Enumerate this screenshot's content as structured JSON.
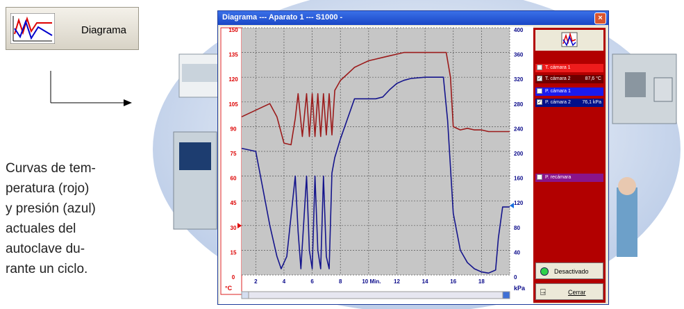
{
  "toolbar": {
    "diagram_label": "Diagrama"
  },
  "caption": {
    "lines": [
      "Curvas de tem-",
      "peratura (rojo)",
      "y presión (azul)",
      "actuales del",
      "autoclave du-",
      "rante un ciclo."
    ]
  },
  "window": {
    "title": "Diagrama --- Aparato 1 --- S1000 -",
    "close_label": "×"
  },
  "axes": {
    "left_unit": "°C",
    "right_unit": "kPa",
    "left_ticks": [
      "150",
      "135",
      "120",
      "105",
      "90",
      "75",
      "60",
      "45",
      "30",
      "15",
      "0"
    ],
    "right_ticks": [
      "400",
      "360",
      "320",
      "280",
      "240",
      "200",
      "160",
      "120",
      "80",
      "40",
      "0"
    ],
    "x_ticks": [
      "2",
      "4",
      "6",
      "8",
      "10 Min.",
      "12",
      "14",
      "16",
      "18"
    ]
  },
  "panel": {
    "channels": [
      {
        "name": "T. cámara 1",
        "value": "",
        "checked": false,
        "color": "#ee1c1c"
      },
      {
        "name": "T. cámara 2",
        "value": "87,6 °C",
        "checked": true,
        "color": "#6d0000"
      },
      {
        "name": "P. cámara 1",
        "value": "",
        "checked": false,
        "color": "#1a1aee"
      },
      {
        "name": "P. cámara 2",
        "value": "76,1 kPa",
        "checked": true,
        "color": "#000f8a"
      },
      {
        "name": "P. recámara",
        "value": "",
        "checked": false,
        "color": "#8a148a"
      }
    ],
    "status_label": "Desactivado",
    "close_label": "Cerrar"
  },
  "chart_data": {
    "type": "line",
    "x_label": "Min.",
    "xlim": [
      1,
      20
    ],
    "left_axis": {
      "unit": "°C",
      "ylim": [
        0,
        150
      ]
    },
    "right_axis": {
      "unit": "kPa",
      "ylim": [
        0,
        400
      ]
    },
    "series": [
      {
        "name": "T. cámara 2",
        "axis": "left",
        "color": "#9b1a1a",
        "x": [
          1,
          2,
          3,
          3.5,
          4,
          4.5,
          4.8,
          5,
          5.3,
          5.6,
          5.8,
          6,
          6.2,
          6.4,
          6.6,
          6.8,
          7,
          7.2,
          7.4,
          7.6,
          8,
          8.5,
          9,
          9.5,
          10,
          10.5,
          11,
          11.5,
          12,
          12.5,
          13,
          14,
          15,
          15.5,
          15.8,
          16,
          16.5,
          17,
          17.5,
          18,
          18.5,
          19,
          19.5,
          20
        ],
        "y": [
          96,
          100,
          104,
          96,
          80,
          79,
          95,
          110,
          84,
          110,
          84,
          110,
          84,
          110,
          84,
          110,
          85,
          110,
          85,
          112,
          118,
          122,
          126,
          128,
          130,
          131,
          132,
          133,
          134,
          135,
          135,
          135,
          135,
          135,
          120,
          90,
          88,
          89,
          88,
          88,
          87,
          87,
          87,
          87
        ]
      },
      {
        "name": "P. cámara 2",
        "axis": "right",
        "color": "#14148c",
        "x": [
          1,
          2,
          2.5,
          3,
          3.5,
          3.8,
          4.2,
          4.8,
          5,
          5.2,
          5.6,
          5.8,
          6,
          6.2,
          6.4,
          6.6,
          6.8,
          7,
          7.2,
          7.4,
          7.6,
          8,
          9,
          9.5,
          10,
          10.5,
          11,
          11.5,
          12,
          12.5,
          13,
          14,
          15,
          15.3,
          15.6,
          16,
          16.5,
          17,
          17.5,
          18,
          18.5,
          19,
          19.2,
          19.5,
          20
        ],
        "y": [
          205,
          200,
          140,
          80,
          30,
          10,
          30,
          160,
          70,
          10,
          160,
          40,
          10,
          160,
          40,
          10,
          160,
          30,
          10,
          165,
          190,
          220,
          285,
          285,
          285,
          285,
          288,
          300,
          310,
          315,
          318,
          320,
          320,
          320,
          250,
          100,
          40,
          20,
          10,
          5,
          3,
          8,
          60,
          110,
          110
        ]
      }
    ]
  }
}
